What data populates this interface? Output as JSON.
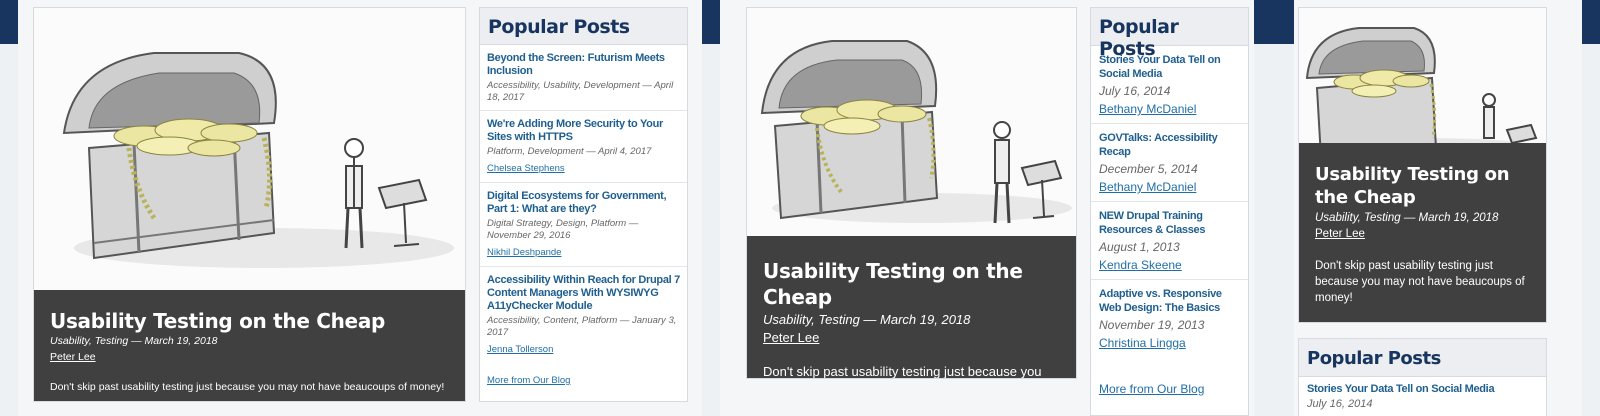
{
  "featured": {
    "title": "Usability Testing on the Cheap",
    "meta": "Usability, Testing — March 19, 2018",
    "author": "Peter Lee",
    "excerpt": "Don't skip past usability testing just because you may not have beaucoups of money!",
    "image_icon": "treasure-chest-illustration"
  },
  "popular": {
    "heading": "Popular Posts",
    "posts_a": [
      {
        "title": "Beyond the Screen: Futurism Meets Inclusion",
        "meta": "Accessibility, Usability, Development — April 18, 2017",
        "author": ""
      },
      {
        "title": "We're Adding More Security to Your Sites with HTTPS",
        "meta": "Platform, Development — April 4, 2017",
        "author": "Chelsea Stephens"
      },
      {
        "title": "Digital Ecosystems for Government, Part 1: What are they?",
        "meta": "Digital Strategy, Design, Platform — November 29, 2016",
        "author": "Nikhil Deshpande"
      },
      {
        "title": "Accessibility Within Reach for Drupal 7 Content Managers With WYSIWYG A11yChecker Module",
        "meta": "Accessibility, Content, Platform — January 3, 2017",
        "author": "Jenna Tollerson"
      }
    ],
    "posts_b": [
      {
        "title": "Stories Your Data Tell on Social Media",
        "date": "July 16, 2014",
        "author": "Bethany McDaniel"
      },
      {
        "title": "GOVTalks: Accessibility Recap",
        "date": "December 5, 2014",
        "author": "Bethany McDaniel"
      },
      {
        "title": "NEW Drupal Training Resources & Classes",
        "date": "August 1, 2013",
        "author": "Kendra Skeene"
      },
      {
        "title": "Adaptive vs. Responsive Web Design: The Basics",
        "date": "November 19, 2013",
        "author": "Christina Lingga"
      }
    ],
    "posts_c": [
      {
        "title": "Stories Your Data Tell on Social Media",
        "date": "July 16, 2014"
      }
    ],
    "more_label": "More from Our Blog"
  },
  "colors": {
    "header_navy": "#17355f",
    "overlay_dark": "#404040",
    "link_blue": "#1f6ea6"
  }
}
